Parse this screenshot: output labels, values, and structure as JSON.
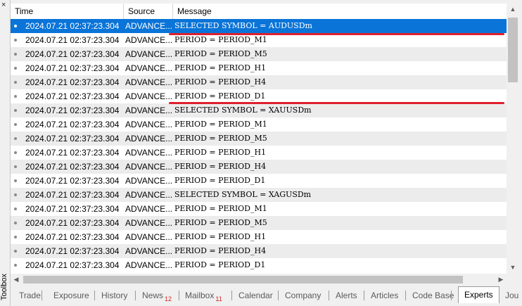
{
  "toolbox": {
    "close": "×",
    "label": "Toolbox"
  },
  "columns": [
    "Time",
    "Source",
    "Message"
  ],
  "rows": [
    {
      "time": "2024.07.21 02:37:23.304",
      "source": "ADVANCE...",
      "message": "SELECTED SYMBOL = AUDUSDm"
    },
    {
      "time": "2024.07.21 02:37:23.304",
      "source": "ADVANCE...",
      "message": "PERIOD = PERIOD_M1"
    },
    {
      "time": "2024.07.21 02:37:23.304",
      "source": "ADVANCE...",
      "message": "PERIOD = PERIOD_M5"
    },
    {
      "time": "2024.07.21 02:37:23.304",
      "source": "ADVANCE...",
      "message": "PERIOD = PERIOD_H1"
    },
    {
      "time": "2024.07.21 02:37:23.304",
      "source": "ADVANCE...",
      "message": "PERIOD = PERIOD_H4"
    },
    {
      "time": "2024.07.21 02:37:23.304",
      "source": "ADVANCE...",
      "message": "PERIOD = PERIOD_D1"
    },
    {
      "time": "2024.07.21 02:37:23.304",
      "source": "ADVANCE...",
      "message": "SELECTED SYMBOL = XAUUSDm"
    },
    {
      "time": "2024.07.21 02:37:23.304",
      "source": "ADVANCE...",
      "message": "PERIOD = PERIOD_M1"
    },
    {
      "time": "2024.07.21 02:37:23.304",
      "source": "ADVANCE...",
      "message": "PERIOD = PERIOD_M5"
    },
    {
      "time": "2024.07.21 02:37:23.304",
      "source": "ADVANCE...",
      "message": "PERIOD = PERIOD_H1"
    },
    {
      "time": "2024.07.21 02:37:23.304",
      "source": "ADVANCE...",
      "message": "PERIOD = PERIOD_H4"
    },
    {
      "time": "2024.07.21 02:37:23.304",
      "source": "ADVANCE...",
      "message": "PERIOD = PERIOD_D1"
    },
    {
      "time": "2024.07.21 02:37:23.304",
      "source": "ADVANCE...",
      "message": "SELECTED SYMBOL = XAGUSDm"
    },
    {
      "time": "2024.07.21 02:37:23.304",
      "source": "ADVANCE...",
      "message": "PERIOD = PERIOD_M1"
    },
    {
      "time": "2024.07.21 02:37:23.304",
      "source": "ADVANCE...",
      "message": "PERIOD = PERIOD_M5"
    },
    {
      "time": "2024.07.21 02:37:23.304",
      "source": "ADVANCE...",
      "message": "PERIOD = PERIOD_H1"
    },
    {
      "time": "2024.07.21 02:37:23.304",
      "source": "ADVANCE...",
      "message": "PERIOD = PERIOD_H4"
    },
    {
      "time": "2024.07.21 02:37:23.304",
      "source": "ADVANCE...",
      "message": "PERIOD = PERIOD_D1"
    }
  ],
  "selected_row": 0,
  "tabs": [
    {
      "label": "Trade",
      "badge": ""
    },
    {
      "label": "Exposure",
      "badge": ""
    },
    {
      "label": "History",
      "badge": ""
    },
    {
      "label": "News",
      "badge": "12"
    },
    {
      "label": "Mailbox",
      "badge": "11"
    },
    {
      "label": "Calendar",
      "badge": ""
    },
    {
      "label": "Company",
      "badge": ""
    },
    {
      "label": "Alerts",
      "badge": ""
    },
    {
      "label": "Articles",
      "badge": ""
    },
    {
      "label": "Code Base",
      "badge": ""
    },
    {
      "label": "Experts",
      "badge": ""
    },
    {
      "label": "Jou",
      "badge": ""
    }
  ],
  "active_tab": 10,
  "colors": {
    "selection": "#0a74d8",
    "annotation_line": "#e0202c",
    "badge": "#d42020"
  }
}
